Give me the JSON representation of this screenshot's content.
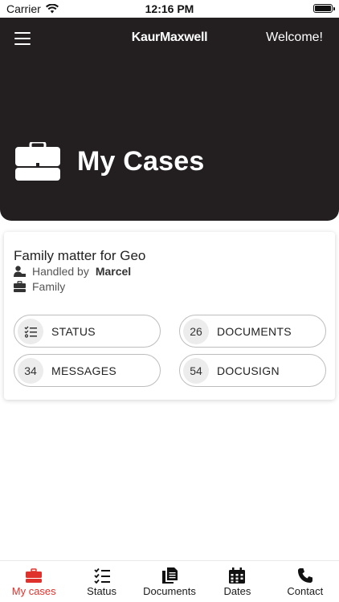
{
  "status_bar": {
    "carrier": "Carrier",
    "time": "12:16 PM"
  },
  "header": {
    "brand": "KaurMaxwell",
    "welcome": "Welcome!",
    "title": "My Cases"
  },
  "case": {
    "title": "Family matter for Geo",
    "handled_prefix": "Handled by",
    "handler": "Marcel",
    "type": "Family",
    "actions": {
      "status": {
        "label": "STATUS"
      },
      "documents": {
        "count": "26",
        "label": "DOCUMENTS"
      },
      "messages": {
        "count": "34",
        "label": "MESSAGES"
      },
      "docusign": {
        "count": "54",
        "label": "DOCUSIGN"
      }
    }
  },
  "tabs": [
    {
      "label": "My cases",
      "icon": "briefcase-icon",
      "active": true
    },
    {
      "label": "Status",
      "icon": "checklist-icon",
      "active": false
    },
    {
      "label": "Documents",
      "icon": "documents-icon",
      "active": false
    },
    {
      "label": "Dates",
      "icon": "calendar-icon",
      "active": false
    },
    {
      "label": "Contact",
      "icon": "phone-icon",
      "active": false
    }
  ],
  "colors": {
    "header_bg": "#231f20",
    "accent": "#e0322d"
  }
}
